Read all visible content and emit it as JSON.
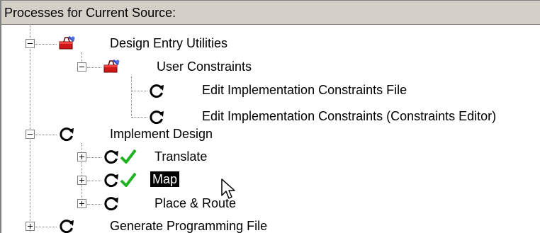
{
  "panel": {
    "header": "Processes for Current Source:"
  },
  "tree": {
    "design_entry": {
      "label": "Design Entry Utilities",
      "icon": "toolbox-icon",
      "expanded": true,
      "user_constraints": {
        "label": "User Constraints",
        "icon": "toolbox-icon",
        "expanded": true,
        "items": [
          {
            "label": "Edit Implementation Constraints File",
            "icon": "process-run-icon"
          },
          {
            "label": "Edit Implementation Constraints (Constraints Editor)",
            "icon": "process-run-icon"
          }
        ]
      }
    },
    "implement": {
      "label": "Implement Design",
      "icon": "process-run-icon",
      "expanded": true,
      "steps": [
        {
          "label": "Translate",
          "status": "completed",
          "icon": "process-run-icon"
        },
        {
          "label": "Map",
          "status": "completed",
          "selected": true,
          "icon": "process-run-icon"
        },
        {
          "label": "Place & Route",
          "icon": "process-run-icon"
        }
      ]
    },
    "generate": {
      "label": "Generate Programming File",
      "icon": "process-run-icon",
      "expanded": false
    }
  },
  "colors": {
    "header_bg": "#d4d0c8",
    "selection_bg": "#000000",
    "check_green": "#1fb31f",
    "toolbox_red": "#d01818"
  }
}
